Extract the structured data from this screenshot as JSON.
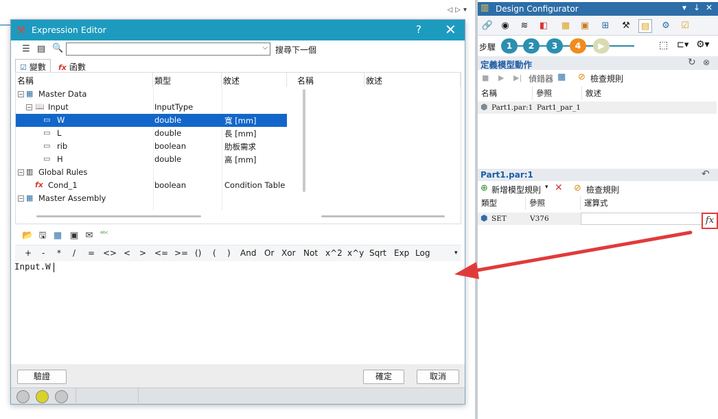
{
  "expression_editor": {
    "title": "Expression Editor",
    "help": "?",
    "close": "✕",
    "search_placeholder": "",
    "search_next": "搜尋下一個",
    "tabs": [
      {
        "label": "變數",
        "icon": "☑"
      },
      {
        "label": "函數",
        "icon": "fx"
      }
    ],
    "tree_columns": [
      "名稱",
      "類型",
      "敘述"
    ],
    "side_columns": [
      "名稱",
      "敘述"
    ],
    "tree_rows": [
      {
        "name": "Master Data",
        "type": "",
        "desc": ""
      },
      {
        "name": "Input",
        "type": "InputType",
        "desc": ""
      },
      {
        "name": "W",
        "type": "double",
        "desc": "寬 [mm]"
      },
      {
        "name": "L",
        "type": "double",
        "desc": "長 [mm]"
      },
      {
        "name": "rib",
        "type": "boolean",
        "desc": "肋板需求"
      },
      {
        "name": "H",
        "type": "double",
        "desc": "高 [mm]"
      },
      {
        "name": "Global Rules",
        "type": "",
        "desc": ""
      },
      {
        "name": "Cond_1",
        "type": "boolean",
        "desc": "Condition Table w"
      },
      {
        "name": "Master Assembly",
        "type": "",
        "desc": ""
      }
    ],
    "operators": [
      "+",
      "-",
      "*",
      "/",
      "=",
      "<>",
      "<",
      ">",
      "<=",
      ">=",
      "()",
      "(",
      ")",
      "And",
      "Or",
      "Xor",
      "Not",
      "x^2",
      "x^y",
      "Sqrt",
      "Exp",
      "Log"
    ],
    "expression": "Input.W",
    "buttons": {
      "verify": "驗證",
      "ok": "確定",
      "cancel": "取消"
    },
    "status_lights": [
      "#c8c8c8",
      "#d8d22a",
      "#c8c8c8"
    ]
  },
  "design_configurator": {
    "title": "Design Configurator",
    "title_controls": [
      "▾",
      "↓",
      "✕"
    ],
    "steps_label": "步驟",
    "steps": [
      {
        "label": "1",
        "color": "#2b8fb0"
      },
      {
        "label": "2",
        "color": "#2b8fb0"
      },
      {
        "label": "3",
        "color": "#2b8fb0"
      },
      {
        "label": "4",
        "color": "#f08c1e"
      },
      {
        "label": "▶",
        "color": "#d9dbb0"
      }
    ],
    "section1_title": "定義模型動作",
    "section1_toolbar": {
      "debugger": "偵錯器",
      "check_rules": "檢查規則"
    },
    "table1_columns": [
      "名稱",
      "參照",
      "敘述"
    ],
    "table1_rows": [
      {
        "name": "Part1.par:1",
        "ref": "Part1_par_1",
        "desc": ""
      }
    ],
    "section2_title": "Part1.par:1",
    "section2_toolbar": {
      "add_rule": "新增模型規則",
      "check_rules": "檢查規則"
    },
    "table2_columns": [
      "類型",
      "參照",
      "運算式"
    ],
    "table2_rows": [
      {
        "type": "SET",
        "ref": "V376",
        "expr": ""
      }
    ],
    "fx_button": "fx"
  },
  "colors": {
    "ee_title_bar": "#1d9bbf",
    "dc_title_bar": "#2d6ea8",
    "selection": "#1366c9",
    "annotation": "#e23a3a"
  }
}
